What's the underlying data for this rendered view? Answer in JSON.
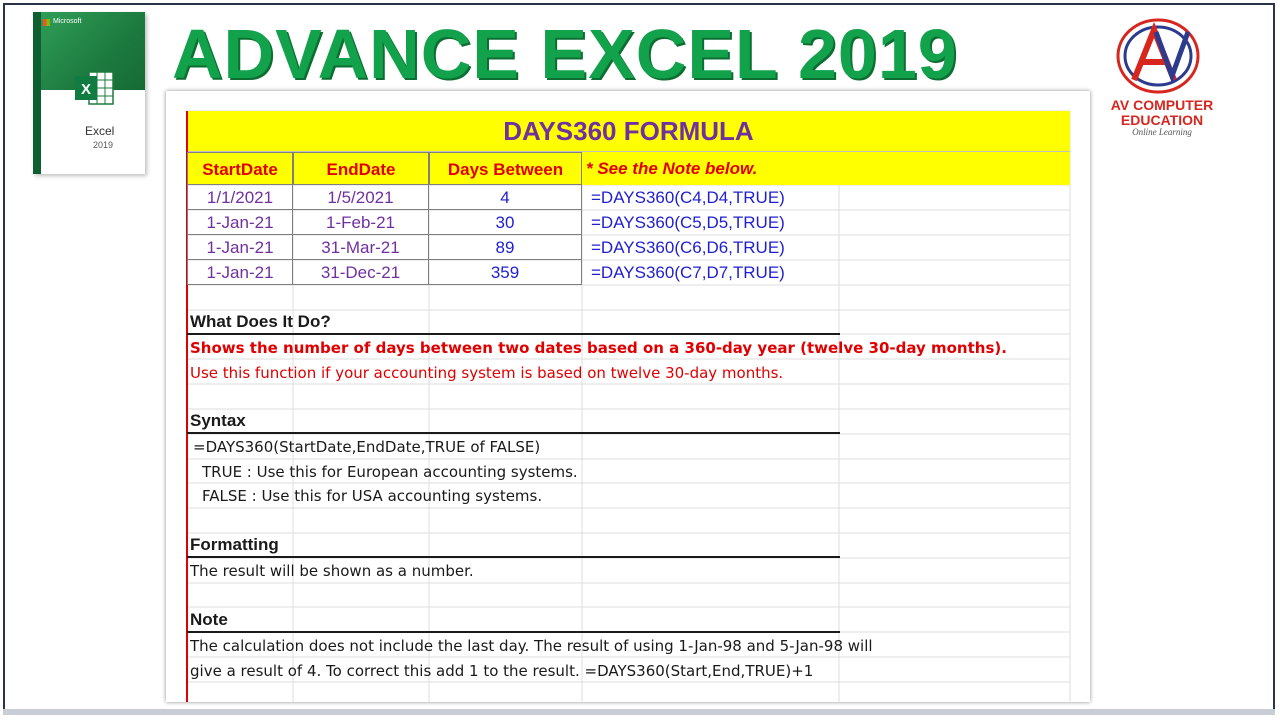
{
  "header": {
    "title": "ADVANCE EXCEL 2019"
  },
  "excel_box": {
    "brand": "Microsoft",
    "product": "Excel",
    "version": "2019"
  },
  "logo": {
    "line1": "AV COMPUTER",
    "line2": "EDUCATION",
    "tagline": "Online Learning",
    "initials": "AV"
  },
  "sheet": {
    "banner_title": "DAYS360 FORMULA",
    "columns": [
      "StartDate",
      "EndDate",
      "Days Between"
    ],
    "note_header": "* See the Note below.",
    "rows": [
      {
        "start": "1/1/2021",
        "end": "1/5/2021",
        "days": "4",
        "formula": "=DAYS360(C4,D4,TRUE)"
      },
      {
        "start": "1-Jan-21",
        "end": "1-Feb-21",
        "days": "30",
        "formula": "=DAYS360(C5,D5,TRUE)"
      },
      {
        "start": "1-Jan-21",
        "end": "31-Mar-21",
        "days": "89",
        "formula": "=DAYS360(C6,D6,TRUE)"
      },
      {
        "start": "1-Jan-21",
        "end": "31-Dec-21",
        "days": "359",
        "formula": "=DAYS360(C7,D7,TRUE)"
      }
    ],
    "what_heading": "What Does It Do?",
    "what_line1": "Shows the number of days between two dates based on a 360-day year (twelve 30-day months).",
    "what_line2": "Use this function if your accounting system is based on twelve 30-day months.",
    "syntax_heading": "Syntax",
    "syntax_line1": "=DAYS360(StartDate,EndDate,TRUE of FALSE)",
    "syntax_line2": "TRUE : Use this for European accounting systems.",
    "syntax_line3": "FALSE : Use this for USA accounting systems.",
    "formatting_heading": "Formatting",
    "formatting_line1": "The result will be shown as a number.",
    "note_heading": "Note",
    "note_line1": "The calculation does not include the last day. The result of using 1-Jan-98 and 5-Jan-98 will",
    "note_line2": "give a result of 4. To correct this add 1 to the result. =DAYS360(Start,End,TRUE)+1"
  },
  "colors": {
    "title_green": "#12a24b",
    "banner_yellow": "#ffff00",
    "banner_purple": "#7030a0",
    "header_red": "#e00000",
    "formula_blue": "#1f1fd0"
  }
}
